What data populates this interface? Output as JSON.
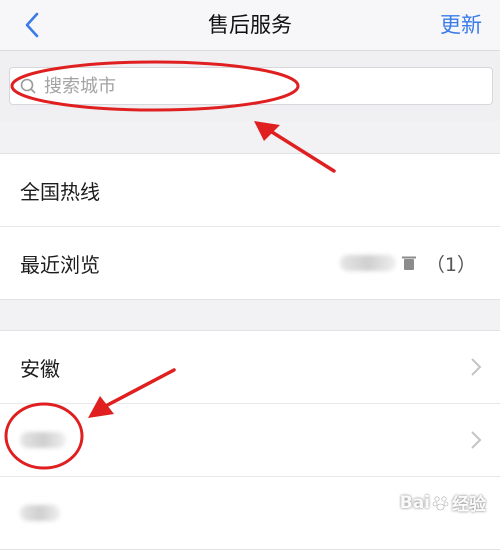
{
  "header": {
    "title": "售后服务",
    "action_label": "更新",
    "back_icon": "chevron-left-icon"
  },
  "search": {
    "placeholder": "搜索城市",
    "icon": "search-icon"
  },
  "section_top": {
    "items": [
      {
        "label": "全国热线"
      },
      {
        "label": "最近浏览",
        "value": "（1）"
      }
    ]
  },
  "section_provinces": {
    "items": [
      {
        "label": "安徽"
      },
      {
        "label": ""
      },
      {
        "label": ""
      }
    ]
  },
  "watermark": {
    "text": "Bai",
    "suffix": "经验"
  },
  "colors": {
    "accent": "#3a7bea",
    "annotation": "#e02020",
    "background": "#f2f2f4"
  }
}
